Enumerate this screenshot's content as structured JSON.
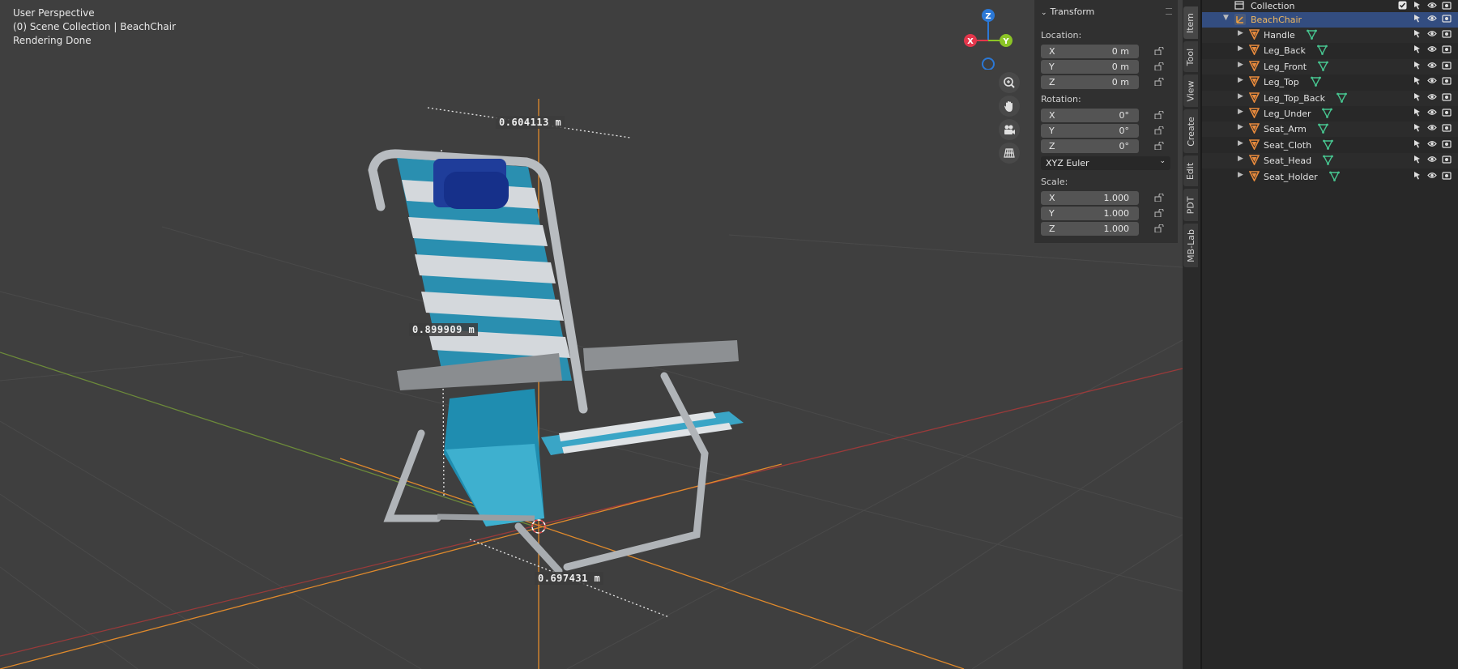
{
  "viewport": {
    "perspective": "User Perspective",
    "collection_path": "(0) Scene Collection | BeachChair",
    "status": "Rendering Done",
    "measurements": [
      "0.604113 m",
      "0.899909 m",
      "0.697431 m"
    ],
    "gizmo_axes": {
      "z": "Z",
      "x": "X",
      "y": "Y"
    },
    "nav_icons": [
      "zoom-icon",
      "hand-icon",
      "camera-icon",
      "grid-icon"
    ]
  },
  "npanel": {
    "title": "Transform",
    "location_label": "Location:",
    "location": [
      {
        "axis": "X",
        "value": "0 m"
      },
      {
        "axis": "Y",
        "value": "0 m"
      },
      {
        "axis": "Z",
        "value": "0 m"
      }
    ],
    "rotation_label": "Rotation:",
    "rotation": [
      {
        "axis": "X",
        "value": "0°"
      },
      {
        "axis": "Y",
        "value": "0°"
      },
      {
        "axis": "Z",
        "value": "0°"
      }
    ],
    "rotation_mode": "XYZ Euler",
    "scale_label": "Scale:",
    "scale": [
      {
        "axis": "X",
        "value": "1.000"
      },
      {
        "axis": "Y",
        "value": "1.000"
      },
      {
        "axis": "Z",
        "value": "1.000"
      }
    ]
  },
  "tabs": [
    "Item",
    "Tool",
    "View",
    "Create",
    "Edit",
    "PDT",
    "MB-Lab"
  ],
  "outliner": {
    "collection": "Collection",
    "parent": "BeachChair",
    "children": [
      "Handle",
      "Leg_Back",
      "Leg_Front",
      "Leg_Top",
      "Leg_Top_Back",
      "Leg_Under",
      "Seat_Arm",
      "Seat_Cloth",
      "Seat_Head",
      "Seat_Holder"
    ]
  },
  "colors": {
    "selection": "#334d80",
    "axis_x": "#e3364b",
    "axis_y": "#8bc426",
    "axis_z": "#2b78d6",
    "orange_axis": "#e08a2c",
    "mesh_icon": "#e88a3c",
    "data_icon": "#47c48f"
  }
}
